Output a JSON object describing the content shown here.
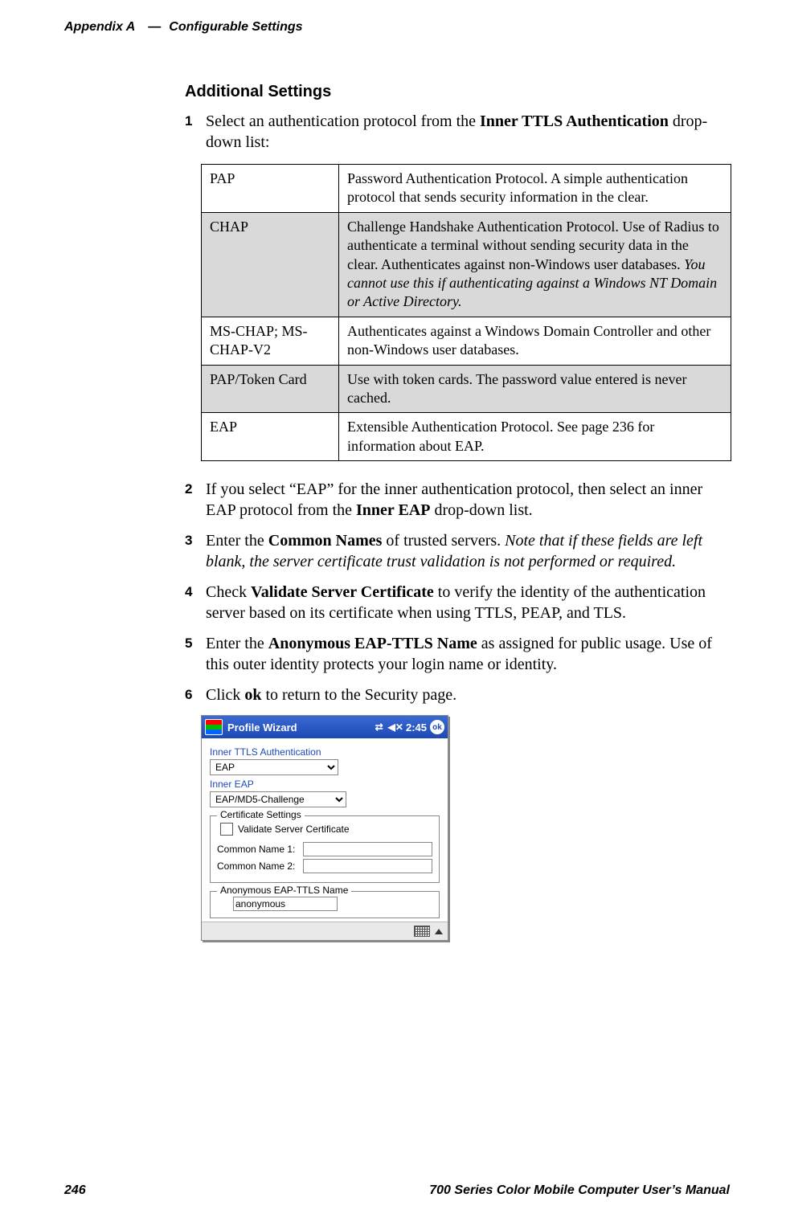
{
  "header": {
    "appendix": "Appendix A",
    "dash": "—",
    "section": "Configurable Settings"
  },
  "heading": "Additional Settings",
  "steps": {
    "s1": {
      "num": "1",
      "pre": "Select an authentication protocol from the ",
      "bold": "Inner TTLS Authentication",
      "post": " drop-down list:"
    },
    "s2": {
      "num": "2",
      "pre": "If you select “EAP” for the inner authentication protocol, then select an inner EAP protocol from the ",
      "bold": "Inner EAP",
      "post": " drop-down list."
    },
    "s3": {
      "num": "3",
      "pre": "Enter the ",
      "bold": "Common Names",
      "mid": " of trusted servers. ",
      "ital": "Note that if these fields are left blank, the server certificate trust validation is not performed or required."
    },
    "s4": {
      "num": "4",
      "pre": "Check ",
      "bold": "Validate Server Certificate",
      "post": " to verify the identity of the authentication server based on its certificate when using TTLS, PEAP, and TLS."
    },
    "s5": {
      "num": "5",
      "pre": "Enter the ",
      "bold": "Anonymous EAP-TTLS Name",
      "post": " as assigned for public usage. Use of this outer identity protects your login name or identity."
    },
    "s6": {
      "num": "6",
      "pre": "Click ",
      "bold": "ok",
      "post": " to return to the Security page."
    }
  },
  "table": {
    "rows": [
      {
        "key": "PAP",
        "val": "Password Authentication Protocol. A simple authentication protocol that sends security information in the clear."
      },
      {
        "key": "CHAP",
        "val_pre": "Challenge Handshake Authentication Protocol. Use of Radius to authenticate a terminal without sending security data in the clear. Authenticates against non-Windows user databases. ",
        "val_ital": "You cannot use this if authenticating against a Windows NT Domain or Active Directory."
      },
      {
        "key": "MS-CHAP; MS-CHAP-V2",
        "val": "Authenticates against a Windows Domain Controller and other non-Windows user databases."
      },
      {
        "key": "PAP/Token Card",
        "val": "Use with token cards. The password value entered is never cached."
      },
      {
        "key": "EAP",
        "val": "Extensible Authentication Protocol. See page 236 for information about EAP."
      }
    ]
  },
  "pda": {
    "title": "Profile Wizard",
    "time": "2:45",
    "ok": "ok",
    "lbl_inner_ttls": "Inner TTLS Authentication",
    "sel_inner_ttls": "EAP",
    "lbl_inner_eap": "Inner EAP",
    "sel_inner_eap": "EAP/MD5-Challenge",
    "fs_cert": "Certificate Settings",
    "cb_validate": "Validate Server Certificate",
    "cn1": "Common Name 1:",
    "cn2": "Common Name 2:",
    "fs_anon": "Anonymous EAP-TTLS Name",
    "anon_value": "anonymous"
  },
  "footer": {
    "page": "246",
    "title": "700 Series Color Mobile Computer User’s Manual"
  }
}
